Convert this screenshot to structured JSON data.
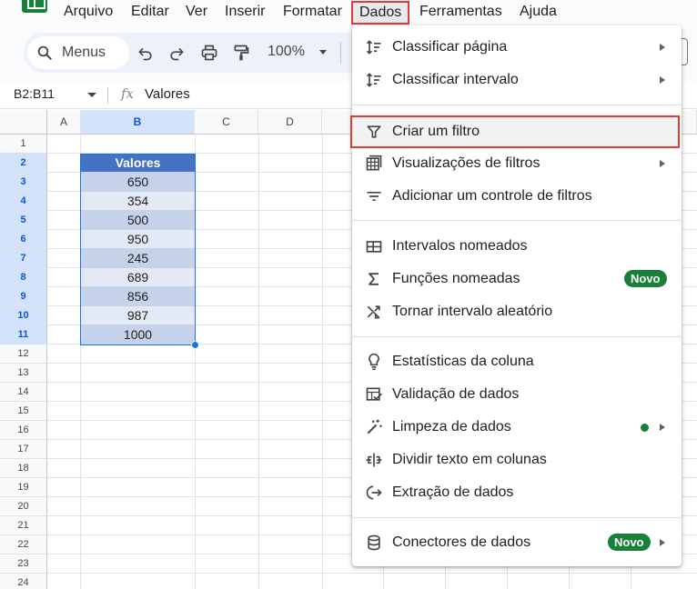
{
  "menubar": {
    "items": [
      "Arquivo",
      "Editar",
      "Ver",
      "Inserir",
      "Formatar",
      "Dados",
      "Ferramentas",
      "Ajuda"
    ],
    "active": "Dados"
  },
  "toolbar": {
    "search_label": "Menus",
    "zoom": "100%"
  },
  "formula_bar": {
    "range": "B2:B11",
    "fx": "fx",
    "value": "Valores"
  },
  "grid": {
    "columns": [
      "A",
      "B",
      "C",
      "D"
    ],
    "rows": [
      "1",
      "2",
      "3",
      "4",
      "5",
      "6",
      "7",
      "8",
      "9",
      "10",
      "11",
      "12",
      "13",
      "14",
      "15",
      "16",
      "17",
      "18",
      "19",
      "20",
      "21",
      "22",
      "23",
      "24"
    ],
    "table_header": "Valores",
    "values": [
      "650",
      "354",
      "500",
      "950",
      "245",
      "689",
      "856",
      "987",
      "1000"
    ]
  },
  "dados_menu": {
    "items": [
      {
        "label": "Classificar página",
        "icon": "sort-icon",
        "submenu": true
      },
      {
        "label": "Classificar intervalo",
        "icon": "sort-icon",
        "submenu": true
      },
      {
        "label": "Criar um filtro",
        "icon": "filter-icon",
        "highlight": true
      },
      {
        "label": "Visualizações de filtros",
        "icon": "filter-views-icon",
        "submenu": true
      },
      {
        "label": "Adicionar um controle de filtros",
        "icon": "slicer-icon"
      },
      {
        "label": "Intervalos nomeados",
        "icon": "named-ranges-icon"
      },
      {
        "label": "Funções nomeadas",
        "icon": "sigma-icon",
        "badge": "Novo"
      },
      {
        "label": "Tornar intervalo aleatório",
        "icon": "shuffle-icon"
      },
      {
        "label": "Estatísticas da coluna",
        "icon": "lightbulb-icon"
      },
      {
        "label": "Validação de dados",
        "icon": "data-validation-icon"
      },
      {
        "label": "Limpeza de dados",
        "icon": "magic-wand-icon",
        "dot": true,
        "submenu": true
      },
      {
        "label": "Dividir texto em colunas",
        "icon": "split-columns-icon"
      },
      {
        "label": "Extração de dados",
        "icon": "extract-icon"
      },
      {
        "label": "Conectores de dados",
        "icon": "database-icon",
        "badge": "Novo",
        "submenu": true
      }
    ]
  },
  "colors": {
    "accent": "#1a73e8",
    "highlight_border": "#e53935",
    "badge": "#188038",
    "table_header": "#4472c4"
  }
}
